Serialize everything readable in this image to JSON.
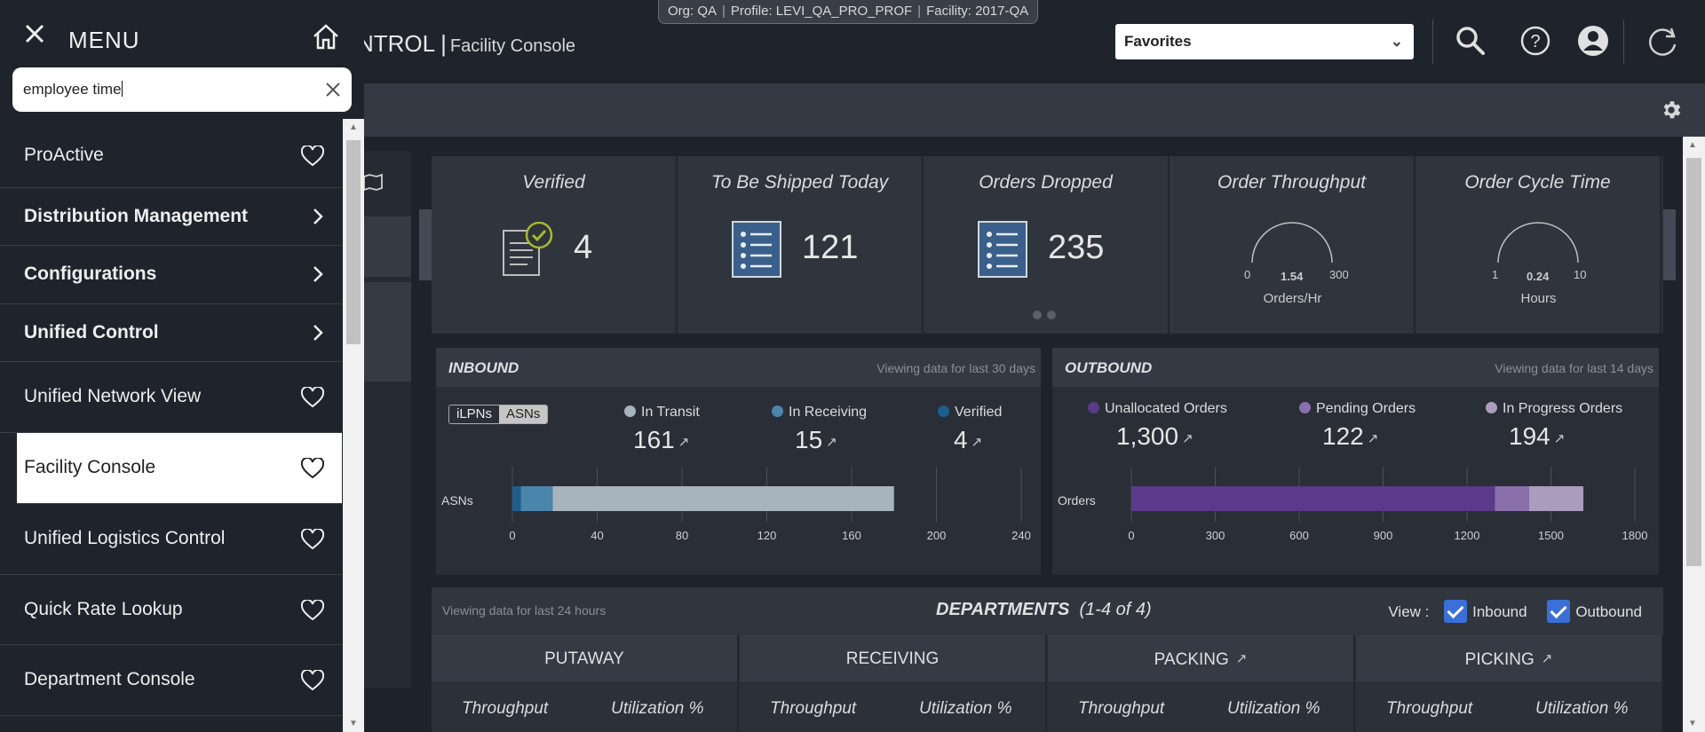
{
  "header": {
    "context": {
      "org": "Org: QA",
      "profile": "Profile: LEVI_QA_PRO_PROF",
      "facility": "Facility: 2017-QA"
    },
    "app_title": "NTROL",
    "app_subtitle": "Facility Console",
    "favorites_label": "Favorites",
    "icons": [
      "search-icon",
      "help-icon",
      "user-icon",
      "refresh-icon"
    ]
  },
  "menu": {
    "title": "MENU",
    "search_value": "employee time",
    "items": [
      {
        "label": "ProActive",
        "icon": "heart-icon"
      },
      {
        "label": "Distribution Management",
        "icon": "chevron-right-icon",
        "bold": true
      },
      {
        "label": "Configurations",
        "icon": "chevron-right-icon",
        "bold": true
      },
      {
        "label": "Unified Control",
        "icon": "chevron-right-icon",
        "bold": true
      },
      {
        "label": "Unified Network View",
        "icon": "heart-icon"
      },
      {
        "label": "Facility Console",
        "icon": "heart-icon",
        "selected": true
      },
      {
        "label": "Unified Logistics Control",
        "icon": "heart-icon"
      },
      {
        "label": "Quick Rate Lookup",
        "icon": "heart-icon"
      },
      {
        "label": "Department Console",
        "icon": "heart-icon"
      }
    ]
  },
  "cards": [
    {
      "title": "Verified",
      "value": "4"
    },
    {
      "title": "To Be Shipped Today",
      "value": "121"
    },
    {
      "title": "Orders Dropped",
      "value": "235"
    },
    {
      "title": "Order Throughput",
      "gauge_min": "0",
      "gauge_value": "1.54",
      "gauge_max": "300",
      "unit": "Orders/Hr"
    },
    {
      "title": "Order Cycle Time",
      "gauge_min": "1",
      "gauge_value": "0.24",
      "gauge_max": "10",
      "unit": "Hours"
    }
  ],
  "inbound": {
    "title": "INBOUND",
    "note": "Viewing data for last 30 days",
    "toggle": [
      "iLPNs",
      "ASNs"
    ],
    "stats": [
      {
        "label": "In Transit",
        "value": "161",
        "color": "#a7b4bd"
      },
      {
        "label": "In Receiving",
        "value": "15",
        "color": "#4a86ab"
      },
      {
        "label": "Verified",
        "value": "4",
        "color": "#1f5d8c"
      }
    ],
    "row_label": "ASNs",
    "ticks": [
      "0",
      "40",
      "80",
      "120",
      "160",
      "200",
      "240"
    ]
  },
  "outbound": {
    "title": "OUTBOUND",
    "note": "Viewing data for last 14 days",
    "stats": [
      {
        "label": "Unallocated Orders",
        "value": "1,300",
        "color": "#5b3a8a"
      },
      {
        "label": "Pending Orders",
        "value": "122",
        "color": "#8a70aa"
      },
      {
        "label": "In Progress Orders",
        "value": "194",
        "color": "#a99cbd"
      }
    ],
    "row_label": "Orders",
    "ticks": [
      "0",
      "300",
      "600",
      "900",
      "1200",
      "1500",
      "1800"
    ]
  },
  "chart_data": [
    {
      "type": "bar",
      "orientation": "horizontal-stacked",
      "categories": [
        "ASNs"
      ],
      "series": [
        {
          "name": "Verified",
          "values": [
            4
          ]
        },
        {
          "name": "In Receiving",
          "values": [
            15
          ]
        },
        {
          "name": "In Transit",
          "values": [
            161
          ]
        }
      ],
      "xlim": [
        0,
        240
      ]
    },
    {
      "type": "bar",
      "orientation": "horizontal-stacked",
      "categories": [
        "Orders"
      ],
      "series": [
        {
          "name": "Unallocated Orders",
          "values": [
            1300
          ]
        },
        {
          "name": "Pending Orders",
          "values": [
            122
          ]
        },
        {
          "name": "In Progress Orders",
          "values": [
            194
          ]
        }
      ],
      "xlim": [
        0,
        1800
      ]
    }
  ],
  "departments": {
    "note": "Viewing data for last 24 hours",
    "title": "DEPARTMENTS",
    "count": "(1-4 of 4)",
    "view_label": "View :",
    "inbound_label": "Inbound",
    "outbound_label": "Outbound",
    "columns": [
      {
        "name": "PUTAWAY",
        "c1": "Throughput",
        "c2": "Utilization %"
      },
      {
        "name": "RECEIVING",
        "c1": "Throughput",
        "c2": "Utilization %"
      },
      {
        "name": "PACKING",
        "c1": "Throughput",
        "c2": "Utilization %"
      },
      {
        "name": "PICKING",
        "c1": "Throughput",
        "c2": "Utilization %"
      }
    ]
  }
}
